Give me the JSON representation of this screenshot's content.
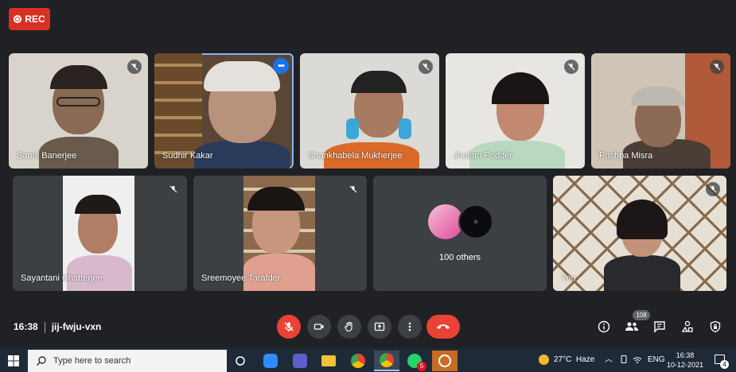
{
  "recording": {
    "label": "REC"
  },
  "participants": [
    {
      "name": "Saoni Banerjee"
    },
    {
      "name": "Sudhir Kakar"
    },
    {
      "name": "Shankhabela Mukherjee"
    },
    {
      "name": "Jhelum Podder"
    },
    {
      "name": "Pushpa Misra"
    },
    {
      "name": "Sayantani Chatterjee"
    },
    {
      "name": "Sreemoyee Tarafder"
    },
    {
      "name": "You"
    }
  ],
  "others": {
    "label": "100 others"
  },
  "meeting": {
    "time": "16:38",
    "code": "jij-fwju-vxn"
  },
  "people_count": "108",
  "taskbar": {
    "search_placeholder": "Type here to search",
    "weather_temp": "27°C",
    "weather_desc": "Haze",
    "language": "ENG",
    "clock_time": "16:38",
    "clock_date": "10-12-2021",
    "whatsapp_badge": "5",
    "notification_count": "4"
  },
  "colors": {
    "accent": "#1a73e8",
    "danger": "#ea4335",
    "background": "#202124"
  }
}
